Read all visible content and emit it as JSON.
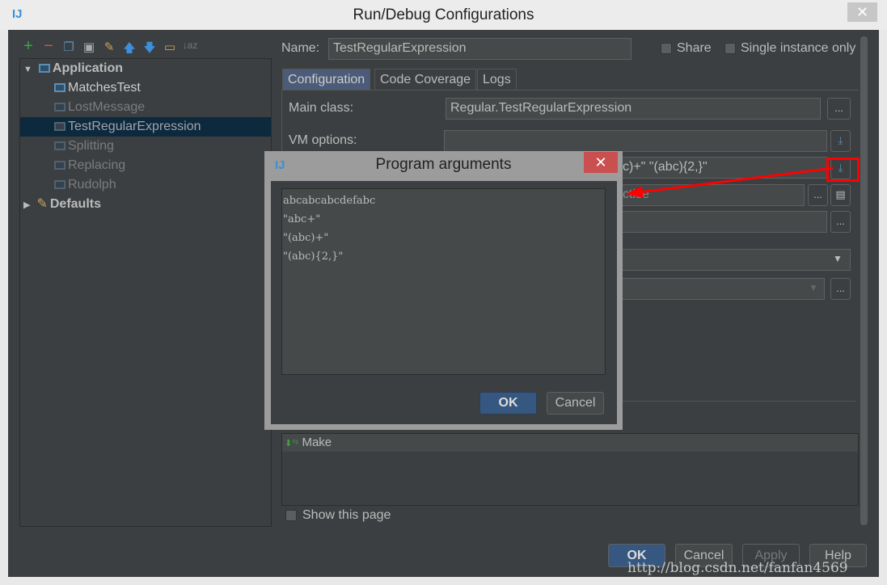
{
  "window": {
    "title": "Run/Debug Configurations",
    "logo": "IJ",
    "close": "✕"
  },
  "toolbar": {
    "icons": [
      "plus-icon",
      "minus-icon",
      "copy-icon",
      "save-icon",
      "wrench-icon",
      "arrow-up-icon",
      "arrow-down-icon",
      "folder-icon",
      "sort-az-icon"
    ]
  },
  "tree": {
    "application": "Application",
    "items": [
      {
        "label": "MatchesTest"
      },
      {
        "label": "LostMessage"
      },
      {
        "label": "TestRegularExpression"
      },
      {
        "label": "Splitting"
      },
      {
        "label": "Replacing"
      },
      {
        "label": "Rudolph"
      }
    ],
    "defaults": "Defaults"
  },
  "form": {
    "name_label": "Name:",
    "name_value": "TestRegularExpression",
    "share": "Share",
    "single_instance": "Single instance only",
    "tabs": [
      "Configuration",
      "Code Coverage",
      "Logs"
    ],
    "main_class_label": "Main class:",
    "main_class_value": "Regular.TestRegularExpression",
    "vm_options_label": "VM options:",
    "vm_options_value": "",
    "program_args_visible": "c)+\" \"(abc){2,}\"",
    "working_dir_visible": "ctise",
    "ellipsis": "...",
    "make": "Make",
    "show_page": "Show this page"
  },
  "buttons": {
    "ok": "OK",
    "cancel": "Cancel",
    "apply": "Apply",
    "help": "Help"
  },
  "popup": {
    "title": "Program arguments",
    "text": "abcabcabcdefabc\n\"abc+\"\n\"(abc)+\"\n\"(abc){2,}\"",
    "ok": "OK",
    "cancel": "Cancel",
    "close": "✕"
  },
  "watermark": "http://blog.csdn.net/fanfan4569",
  "colors": {
    "background": "#3c3f41",
    "selection": "#0d293e",
    "accent": "#365880",
    "annotation": "#ff0000"
  }
}
